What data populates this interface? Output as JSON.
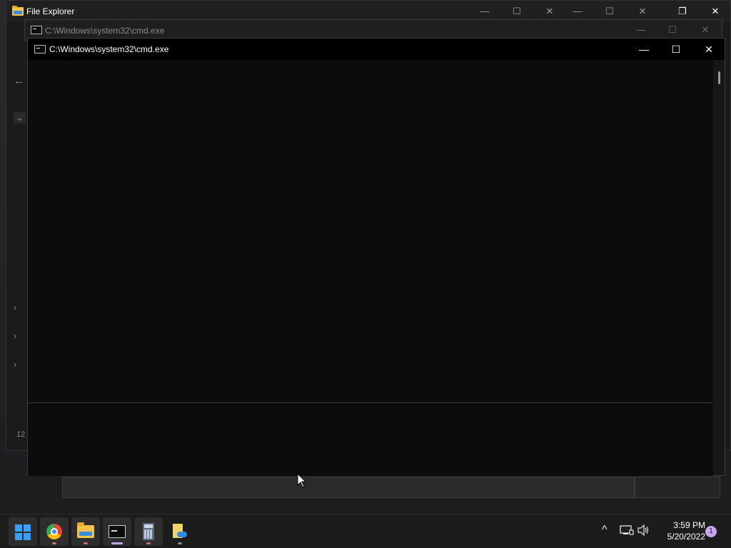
{
  "explorer": {
    "title": "File Explorer",
    "minimize_glyph": "—",
    "maximize_glyph": "☐",
    "close_glyph": "✕",
    "restore_glyph": "❐",
    "status_fragment": "12"
  },
  "cmd_back": {
    "title": "C:\\Windows\\system32\\cmd.exe",
    "minimize_glyph": "—",
    "maximize_glyph": "☐",
    "close_glyph": "✕"
  },
  "cmd_front": {
    "title": "C:\\Windows\\system32\\cmd.exe",
    "minimize_glyph": "—",
    "maximize_glyph": "☐",
    "close_glyph": "✕"
  },
  "taskbar": {
    "apps": [
      {
        "name": "start-button",
        "icon": "windows-icon"
      },
      {
        "name": "chrome",
        "icon": "chrome-icon"
      },
      {
        "name": "file-explorer",
        "icon": "folder-icon"
      },
      {
        "name": "command-prompt",
        "icon": "cmd-icon"
      },
      {
        "name": "calculator",
        "icon": "calculator-icon"
      },
      {
        "name": "onedrive",
        "icon": "onedrive-icon"
      }
    ],
    "tray_chevron": "^",
    "clock_time": "3:59 PM",
    "clock_date": "5/20/2022",
    "notification_count": "1"
  },
  "colors": {
    "accent": "#3aa0ff",
    "console_bg": "#0c0c0c",
    "taskbar_bg": "#1c1c1c"
  }
}
